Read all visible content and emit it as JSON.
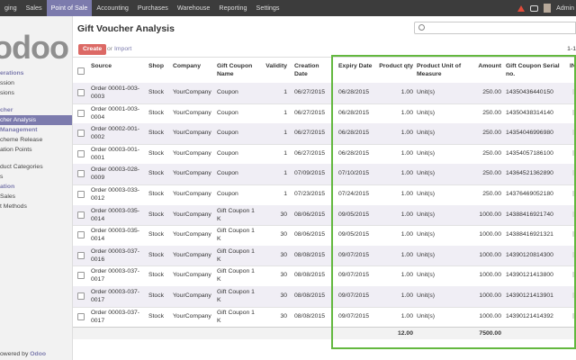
{
  "topbar": {
    "menus": [
      "ging",
      "Sales",
      "Point of Sale",
      "Accounting",
      "Purchases",
      "Warehouse",
      "Reporting",
      "Settings"
    ],
    "active_menu": "Point of Sale",
    "user": "Admin"
  },
  "sidebar": {
    "logo": "odoo",
    "items": [
      {
        "label": "erations",
        "type": "section"
      },
      {
        "label": "ssion",
        "type": "item"
      },
      {
        "label": "sions",
        "type": "item"
      },
      {
        "label": "",
        "type": "gap"
      },
      {
        "label": "cher",
        "type": "section"
      },
      {
        "label": "cher Analysis",
        "type": "active"
      },
      {
        "label": "Management",
        "type": "section"
      },
      {
        "label": "cheme Release",
        "type": "item"
      },
      {
        "label": "ation Points",
        "type": "item"
      },
      {
        "label": "",
        "type": "gap"
      },
      {
        "label": "duct Categories",
        "type": "item"
      },
      {
        "label": "s",
        "type": "item"
      },
      {
        "label": "ation",
        "type": "section"
      },
      {
        "label": "Sales",
        "type": "item"
      },
      {
        "label": "t Methods",
        "type": "item"
      }
    ],
    "powered_prefix": "owered by ",
    "powered_brand": "Odoo"
  },
  "page": {
    "title": "Gift Voucher Analysis",
    "create_label": "Create",
    "or_text": "or",
    "import_label": "Import",
    "pager": "1-1"
  },
  "table": {
    "headers": [
      "Source",
      "Shop",
      "Company",
      "Gift Coupon Name",
      "Validity",
      "Creation Date",
      "Expiry Date",
      "Product qty",
      "Product Unit of Measure",
      "Amount",
      "Gift Coupon Serial no.",
      "IN"
    ],
    "rows": [
      [
        "Order 00001-003-0003",
        "Stock",
        "YourCompany",
        "Coupon",
        "1",
        "06/27/2015",
        "06/28/2015",
        "1.00",
        "Unit(s)",
        "250.00",
        "14350436440150"
      ],
      [
        "Order 00001-003-0004",
        "Stock",
        "YourCompany",
        "Coupon",
        "1",
        "06/27/2015",
        "06/28/2015",
        "1.00",
        "Unit(s)",
        "250.00",
        "14350438314140"
      ],
      [
        "Order 00002-001-0002",
        "Stock",
        "YourCompany",
        "Coupon",
        "1",
        "06/27/2015",
        "06/28/2015",
        "1.00",
        "Unit(s)",
        "250.00",
        "14354046996980"
      ],
      [
        "Order 00003-001-0001",
        "Stock",
        "YourCompany",
        "Coupon",
        "1",
        "06/27/2015",
        "06/28/2015",
        "1.00",
        "Unit(s)",
        "250.00",
        "14354057186100"
      ],
      [
        "Order 00003-028-0009",
        "Stock",
        "YourCompany",
        "Coupon",
        "1",
        "07/09/2015",
        "07/10/2015",
        "1.00",
        "Unit(s)",
        "250.00",
        "14364521362890"
      ],
      [
        "Order 00003-033-0012",
        "Stock",
        "YourCompany",
        "Coupon",
        "1",
        "07/23/2015",
        "07/24/2015",
        "1.00",
        "Unit(s)",
        "250.00",
        "14376469052180"
      ],
      [
        "Order 00003-035-0014",
        "Stock",
        "YourCompany",
        "Gift Coupon 1 K",
        "30",
        "08/06/2015",
        "09/05/2015",
        "1.00",
        "Unit(s)",
        "1000.00",
        "14388416921740"
      ],
      [
        "Order 00003-035-0014",
        "Stock",
        "YourCompany",
        "Gift Coupon 1 K",
        "30",
        "08/06/2015",
        "09/05/2015",
        "1.00",
        "Unit(s)",
        "1000.00",
        "14388416921321"
      ],
      [
        "Order 00003-037-0016",
        "Stock",
        "YourCompany",
        "Gift Coupon 1 K",
        "30",
        "08/08/2015",
        "09/07/2015",
        "1.00",
        "Unit(s)",
        "1000.00",
        "14390120814300"
      ],
      [
        "Order 00003-037-0017",
        "Stock",
        "YourCompany",
        "Gift Coupon 1 K",
        "30",
        "08/08/2015",
        "09/07/2015",
        "1.00",
        "Unit(s)",
        "1000.00",
        "14390121413800"
      ],
      [
        "Order 00003-037-0017",
        "Stock",
        "YourCompany",
        "Gift Coupon 1 K",
        "30",
        "08/08/2015",
        "09/07/2015",
        "1.00",
        "Unit(s)",
        "1000.00",
        "14390121413901"
      ],
      [
        "Order 00003-037-0017",
        "Stock",
        "YourCompany",
        "Gift Coupon 1 K",
        "30",
        "08/08/2015",
        "09/07/2015",
        "1.00",
        "Unit(s)",
        "1000.00",
        "14390121414392"
      ]
    ],
    "totals": {
      "qty": "12.00",
      "amount": "7500.00"
    }
  },
  "colors": {
    "brand": "#7c7bad",
    "create": "#dc6965",
    "highlight": "#63b83f"
  }
}
